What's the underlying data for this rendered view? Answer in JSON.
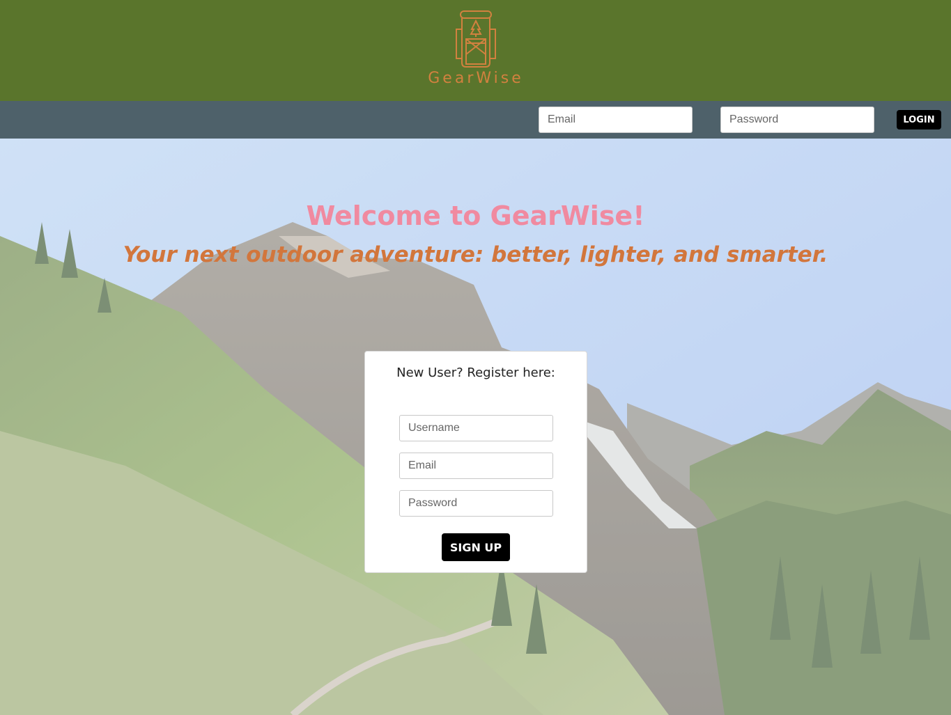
{
  "brand": {
    "name": "GearWise",
    "logo_icon": "backpack-icon",
    "colors": {
      "header": "#5a752c",
      "logo": "#d2813f",
      "navbar": "#4e616a"
    }
  },
  "login": {
    "email_placeholder": "Email",
    "password_placeholder": "Password",
    "button_label": "LOGIN"
  },
  "hero": {
    "welcome": "Welcome to GearWise!",
    "tagline": "Your next outdoor adventure: better, lighter, and smarter."
  },
  "register": {
    "title": "New User? Register here:",
    "username_placeholder": "Username",
    "email_placeholder": "Email",
    "password_placeholder": "Password",
    "button_label": "SIGN UP"
  }
}
